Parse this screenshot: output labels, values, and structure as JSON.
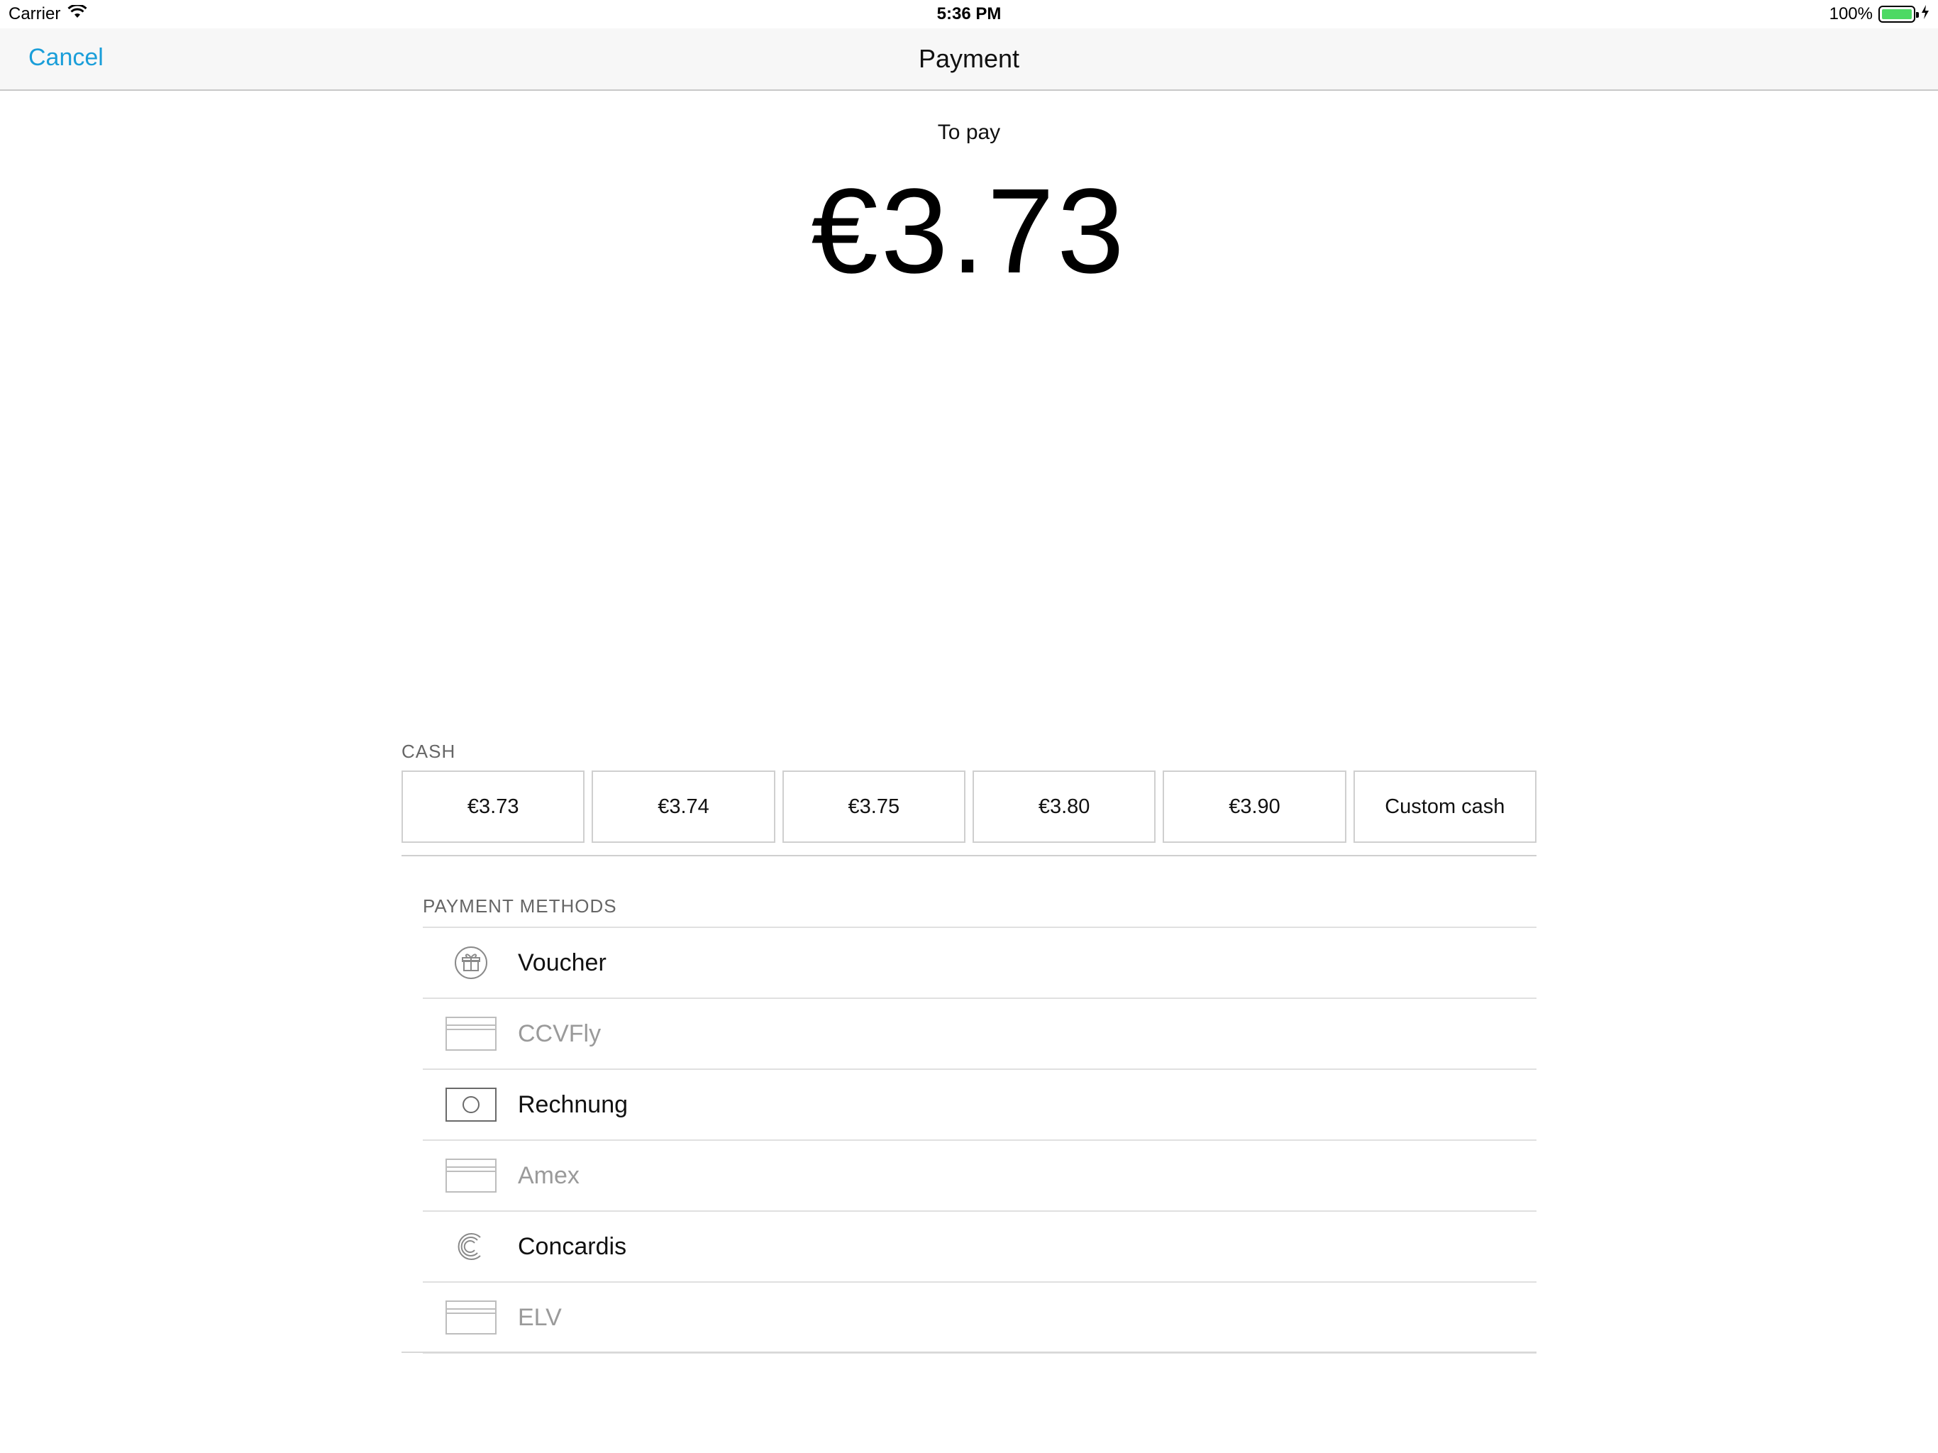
{
  "status_bar": {
    "carrier": "Carrier",
    "time": "5:36 PM",
    "battery_percent": "100%",
    "battery_level": 1.0,
    "battery_color": "#4cd964"
  },
  "nav": {
    "cancel_label": "Cancel",
    "title": "Payment",
    "accent_color": "#1a9ed9"
  },
  "amount_section": {
    "label": "To pay",
    "amount": "€3.73"
  },
  "cash": {
    "section_label": "CASH",
    "buttons": [
      "€3.73",
      "€3.74",
      "€3.75",
      "€3.80",
      "€3.90",
      "Custom cash"
    ]
  },
  "payment_methods": {
    "section_label": "PAYMENT METHODS",
    "items": [
      {
        "label": "Voucher",
        "icon": "gift-icon",
        "enabled": true
      },
      {
        "label": "CCVFly",
        "icon": "card-icon",
        "enabled": false
      },
      {
        "label": "Rechnung",
        "icon": "cash-note-icon",
        "enabled": true
      },
      {
        "label": "Amex",
        "icon": "card-icon",
        "enabled": false
      },
      {
        "label": "Concardis",
        "icon": "concardis-logo-icon",
        "enabled": true
      },
      {
        "label": "ELV",
        "icon": "card-icon",
        "enabled": false
      }
    ]
  }
}
